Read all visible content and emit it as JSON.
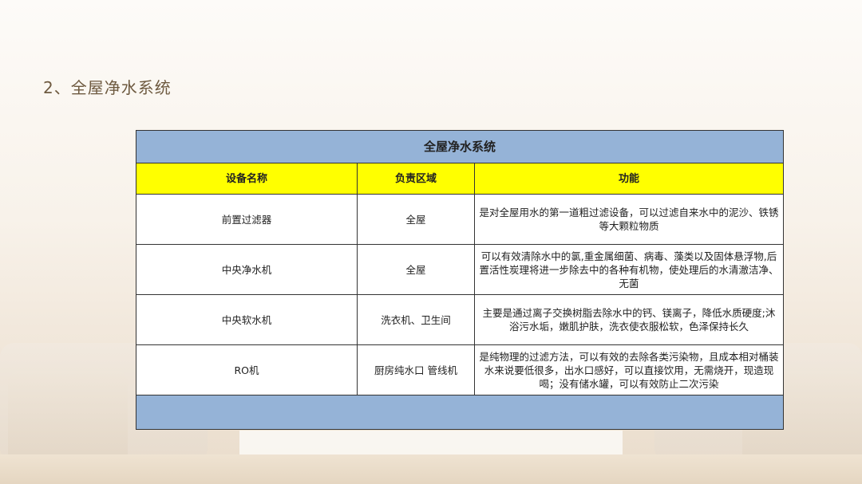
{
  "page": {
    "title": "2、全屋净水系统"
  },
  "table": {
    "caption": "全屋净水系统",
    "headers": [
      "设备名称",
      "负责区域",
      "功能"
    ],
    "rows": [
      {
        "name": "前置过滤器",
        "area": "全屋",
        "function": "是对全屋用水的第一道粗过滤设备，可以过滤自来水中的泥沙、铁锈等大颗粒物质"
      },
      {
        "name": "中央净水机",
        "area": "全屋",
        "function": "可以有效清除水中的氯,重金属细菌、病毒、藻类以及固体悬浮物,后置活性炭理将进一步除去中的各种有机物，使处理后的水清澈洁净、无菌"
      },
      {
        "name": "中央软水机",
        "area": "洗衣机、卫生间",
        "function": "主要是通过离子交换树脂去除水中的钙、镁离子，降低水质硬度;沐浴污水垢，嫩肌护肤，洗衣使衣服松软，色泽保持长久"
      },
      {
        "name": "RO机",
        "area": "厨房纯水口 管线机",
        "function": "是纯物理的过滤方法，可以有效的去除各类污染物，且成本相对桶装水来说要低很多，出水口感好，可以直接饮用，无需烧开，现造现喝；没有储水罐，可以有效防止二次污染"
      }
    ]
  }
}
